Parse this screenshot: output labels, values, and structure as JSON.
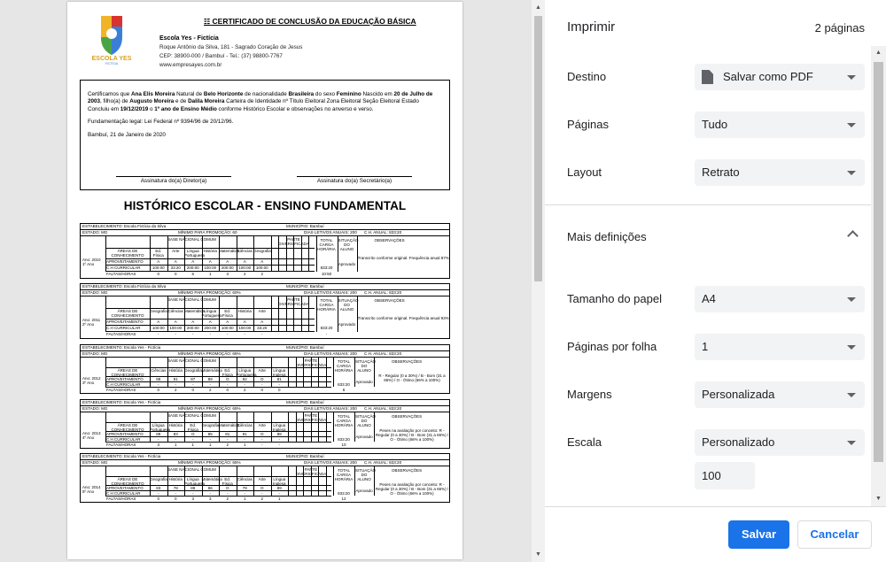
{
  "preview": {
    "certificate": {
      "title": "CERTIFICADO DE CONCLUSÃO DA EDUCAÇÃO BÁSICA",
      "logo_text": "ESCOLA YES",
      "logo_subtext": "FICTÍCIA",
      "school_name": "Escola Yes - Fictícia",
      "address": "Roque Antônio da Silva, 181 - Sagrado Coração de Jesus",
      "cep_line": "CEP: 38900-000 / Bambuí - Tel.: (37) 98800-7767",
      "website": "www.empresayes.com.br",
      "body": {
        "p1_pre": "Certificamos que ",
        "student": "Ana Elis Moreira",
        "p1_a": " Natural de ",
        "city": "Belo Horizonte",
        "p1_b": " de nacionalidade ",
        "nationality": "Brasileira",
        "p1_c": " do sexo ",
        "sex": "Feminino",
        "p1_d": " Nascido em ",
        "birth": "20 de Julho de 2003",
        "p1_e": ", filho(a) de ",
        "father": "Augusto Moreira",
        "p1_f": " e de ",
        "mother": "Dalila Moreira",
        "p1_g": " Carteira de Identidade nº Título Eleitoral Zona Eleitoral Seção Eleitoral Estado Concluiu em ",
        "date": "19/12/2019",
        "p1_h": " o ",
        "course": "1º ano de Ensino Médio",
        "p1_i": " conforme Histórico Escolar e observações no anverso e verso."
      },
      "legal": "Fundamentação legal: Lei Federal nº 9394/96 de 20/12/96.",
      "place_date": "Bambuí, 21 de Janeiro de 2020",
      "sig_director": "Assinatura do(a) Diretor(a)",
      "sig_secretary": "Assinatura do(a) Secretário(a)"
    },
    "history_title": "HISTÓRICO ESCOLAR - ENSINO FUNDAMENTAL",
    "years": [
      {
        "estab": "ESTABELECIMENTO: Escola Fictícia da Silva",
        "municipio": "MUNICÍPIO: Bambuí",
        "estado": "ESTADO: MG",
        "minimo": "MÍNIMO PARA PROMOÇÃO: 60",
        "dias": "DIAS LETIVOS ANUAIS: 200",
        "ch": "C.H. ANUAL: 833:20",
        "ano": "Ano: 2010 1º Ano",
        "subjects": [
          "Ed. Física",
          "Arte",
          "Língua Portuguesa",
          "História",
          "Matemática",
          "Ciências",
          "Geografia"
        ],
        "aproveitamento": [
          "A",
          "A",
          "A",
          "A",
          "A",
          "A",
          "A"
        ],
        "ch_row": [
          "100:00",
          "33:20",
          "200:00",
          "100:00",
          "200:00",
          "100:00",
          "100:00"
        ],
        "faltas": [
          "0",
          "0",
          "5",
          "1",
          "3",
          "2",
          "2"
        ],
        "total": [
          "833:20",
          "10:50"
        ],
        "situacao": "Aprovado",
        "obs": "Transcrito conforme original. Frequência anual 87%"
      },
      {
        "estab": "ESTABELECIMENTO: Escola Fictícia da Silva",
        "municipio": "MUNICÍPIO: Bambuí",
        "estado": "ESTADO: MG",
        "minimo": "MÍNIMO PARA PROMOÇÃO: 60%",
        "dias": "DIAS LETIVOS ANUAIS: 200",
        "ch": "C.H. ANUAL: 833:20",
        "ano": "Ano: 2011 2º Ano",
        "subjects": [
          "Geografia",
          "Ciências",
          "Matemática",
          "Língua Portuguesa",
          "Ed. Física",
          "História",
          "Arte"
        ],
        "aproveitamento": [
          "A",
          "A",
          "A",
          "A",
          "A",
          "A",
          "A"
        ],
        "ch_row": [
          "100:00",
          "100:00",
          "200:00",
          "200:00",
          "100:00",
          "100:00",
          "33:20"
        ],
        "faltas": [
          "-",
          "-",
          "-",
          "-",
          "-",
          "-",
          "-"
        ],
        "total": [
          "833:20",
          "-"
        ],
        "situacao": "Aprovado",
        "obs": "Transcrito conforme original. Frequência anual 93%"
      },
      {
        "estab": "ESTABELECIMENTO: Escola Yes - Fictícia",
        "municipio": "MUNICÍPIO: Bambuí",
        "estado": "ESTADO: MG",
        "minimo": "MÍNIMO PARA PROMOÇÃO: 65%",
        "dias": "DIAS LETIVOS ANUAIS: 200",
        "ch": "C.H. ANUAL: 833:20",
        "ano": "Ano: 2012 3º Ano",
        "subjects": [
          "Ciências",
          "História",
          "Geografia",
          "Matemática",
          "Ed. Física",
          "Língua Portuguesa",
          "Arte",
          "Língua Inglesa"
        ],
        "aproveitamento": [
          "89",
          "91",
          "87",
          "89",
          "O",
          "92",
          "O",
          "81"
        ],
        "ch_row": [
          "-",
          "-",
          "-",
          "-",
          "-",
          "-",
          "-",
          "-"
        ],
        "faltas": [
          "0",
          "2",
          "0",
          "2",
          "0",
          "2",
          "0",
          "0"
        ],
        "total": [
          "833:20",
          "6"
        ],
        "situacao": "Aprovado",
        "obs": "R - Regular (0 a 30%) / B - Bom (31 a 65%) / O - Ótimo (66% a 100%)"
      },
      {
        "estab": "ESTABELECIMENTO: Escola Yes - Fictícia",
        "municipio": "MUNICÍPIO: Bambuí",
        "estado": "ESTADO: MG",
        "minimo": "MÍNIMO PARA PROMOÇÃO: 65%",
        "dias": "DIAS LETIVOS ANUAIS: 200",
        "ch": "C.H. ANUAL: 833:20",
        "ano": "Ano: 2013 4º Ano",
        "subjects": [
          "Língua Portuguesa",
          "História",
          "Ed. Física",
          "Geografia",
          "Matemática",
          "Ciências",
          "Arte",
          "Língua Inglesa"
        ],
        "aproveitamento": [
          "89",
          "83",
          "O",
          "85",
          "81",
          "91",
          "O",
          "88"
        ],
        "ch_row": [
          "-",
          "-",
          "-",
          "-",
          "-",
          "-",
          "-",
          "-"
        ],
        "faltas": [
          "3",
          "1",
          "1",
          "1",
          "2",
          "1",
          "-",
          "-"
        ],
        "total": [
          "833:20",
          "10"
        ],
        "situacao": "Aprovado",
        "obs": "Peses na avaliação por conceito: R - Regular (0 a 30%) / B - Bom (31 a 65%) / O - Ótimo (66% a 100%)"
      },
      {
        "estab": "ESTABELECIMENTO: Escola Yes - Fictícia",
        "municipio": "MUNICÍPIO: Bambuí",
        "estado": "ESTADO: MG",
        "minimo": "MÍNIMO PARA PROMOÇÃO: 65%",
        "dias": "DIAS LETIVOS ANUAIS: 200",
        "ch": "C.H. ANUAL: 833:20",
        "ano": "Ano: 2014 5º Ano",
        "subjects": [
          "Geografia",
          "História",
          "Língua Portuguesa",
          "Matemática",
          "Ed. Física",
          "Ciências",
          "Arte",
          "Língua Inglesa"
        ],
        "aproveitamento": [
          "83",
          "78",
          "89",
          "86",
          "O",
          "79",
          "O",
          "89"
        ],
        "ch_row": [
          "-",
          "-",
          "-",
          "-",
          "-",
          "-",
          "-",
          "-"
        ],
        "faltas": [
          "0",
          "0",
          "3",
          "3",
          "2",
          "1",
          "2",
          "1"
        ],
        "total": [
          "833:20",
          "12"
        ],
        "situacao": "Aprovado",
        "obs": "Peses na avaliação por conceito: R - Regular (0 a 30%) / B - Bom (31 a 65%) / O - Ótimo (66% a 100%)"
      }
    ],
    "labels": {
      "areas": "ÁREAS DE CONHECIMENTO",
      "base": "BASE NACIONAL COMUM",
      "parte": "PARTE DIVERSIFICADA",
      "total": "TOTAL CARGA HORÁRIA",
      "situacao": "SITUAÇÃO DO ALUNO",
      "obs": "OBSERVAÇÕES",
      "aprov": "APROVEITAMENTO",
      "ch": "C.H CURRICULAR",
      "faltas": "FALTAS/HORAS"
    }
  },
  "panel": {
    "title": "Imprimir",
    "page_count": "2 páginas",
    "destination_label": "Destino",
    "destination_value": "Salvar como PDF",
    "pages_label": "Páginas",
    "pages_value": "Tudo",
    "layout_label": "Layout",
    "layout_value": "Retrato",
    "more_settings": "Mais definições",
    "paper_label": "Tamanho do papel",
    "paper_value": "A4",
    "per_sheet_label": "Páginas por folha",
    "per_sheet_value": "1",
    "margins_label": "Margens",
    "margins_value": "Personalizada",
    "scale_label": "Escala",
    "scale_value": "Personalizado",
    "scale_number": "100",
    "save_button": "Salvar",
    "cancel_button": "Cancelar"
  }
}
